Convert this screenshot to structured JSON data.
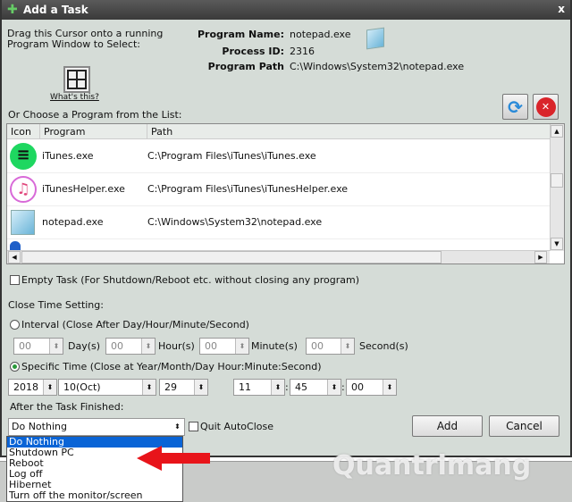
{
  "window": {
    "title": "Add a Task",
    "close": "x"
  },
  "drag": {
    "text1": "Drag this Cursor onto a running",
    "text2": "Program Window to Select:",
    "whats_this": "What's this?"
  },
  "info": {
    "name_label": "Program Name:",
    "name": "notepad.exe",
    "pid_label": "Process ID:",
    "pid": "2316",
    "path_label": "Program Path",
    "path": "C:\\Windows\\System32\\notepad.exe"
  },
  "list": {
    "caption": "Or Choose a Program from the List:",
    "headers": [
      "Icon",
      "Program",
      "Path"
    ],
    "rows": [
      {
        "program": "iTunes.exe",
        "path": "C:\\Program Files\\iTunes\\iTunes.exe"
      },
      {
        "program": "iTunesHelper.exe",
        "path": "C:\\Program Files\\iTunes\\iTunesHelper.exe"
      },
      {
        "program": "notepad.exe",
        "path": "C:\\Windows\\System32\\notepad.exe"
      }
    ]
  },
  "empty_task": "Empty Task (For Shutdown/Reboot etc. without closing any program)",
  "close_time": {
    "heading": "Close Time Setting:",
    "interval_label": "Interval (Close After Day/Hour/Minute/Second)",
    "interval": [
      {
        "value": "00",
        "unit": "Day(s)"
      },
      {
        "value": "00",
        "unit": "Hour(s)"
      },
      {
        "value": "00",
        "unit": "Minute(s)"
      },
      {
        "value": "00",
        "unit": "Second(s)"
      }
    ],
    "specific_label": "Specific Time (Close at Year/Month/Day Hour:Minute:Second)",
    "year": "2018",
    "month": "10(Oct)",
    "day": "29",
    "hour": "11",
    "minute": "45",
    "second": "00",
    "sep": ":"
  },
  "after": {
    "label": "After the Task Finished:",
    "selected": "Do Nothing",
    "quit_autoclose": "Quit AutoClose",
    "options": [
      "Do Nothing",
      "Shutdown PC",
      "Reboot",
      "Log off",
      "Hibernet",
      "Turn off the monitor/screen"
    ]
  },
  "buttons": {
    "add": "Add",
    "cancel": "Cancel"
  },
  "watermark": "Quantrimang",
  "colors": {
    "accent": "#0a64d6",
    "arrow": "#e8141a"
  }
}
